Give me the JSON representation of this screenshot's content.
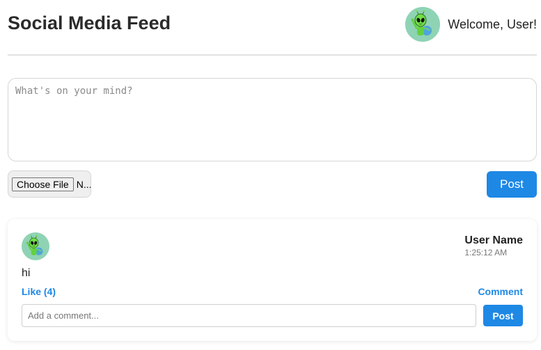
{
  "header": {
    "title": "Social Media Feed",
    "welcome": "Welcome, User!",
    "avatar_icon": "alien-avatar-icon"
  },
  "composer": {
    "placeholder": "What's on your mind?",
    "value": "",
    "file_button_label": "Choose File",
    "file_name_truncated": "N...",
    "post_label": "Post"
  },
  "feed": {
    "posts": [
      {
        "username": "User Name",
        "time": "1:25:12 AM",
        "content": "hi",
        "like_label": "Like (4)",
        "comment_label": "Comment",
        "comment_placeholder": "Add a comment...",
        "comment_post_label": "Post",
        "avatar_icon": "alien-avatar-icon"
      }
    ]
  },
  "colors": {
    "accent": "#1e88e5",
    "avatar_bg": "#8fd3b5",
    "divider": "#e3e3e3"
  }
}
